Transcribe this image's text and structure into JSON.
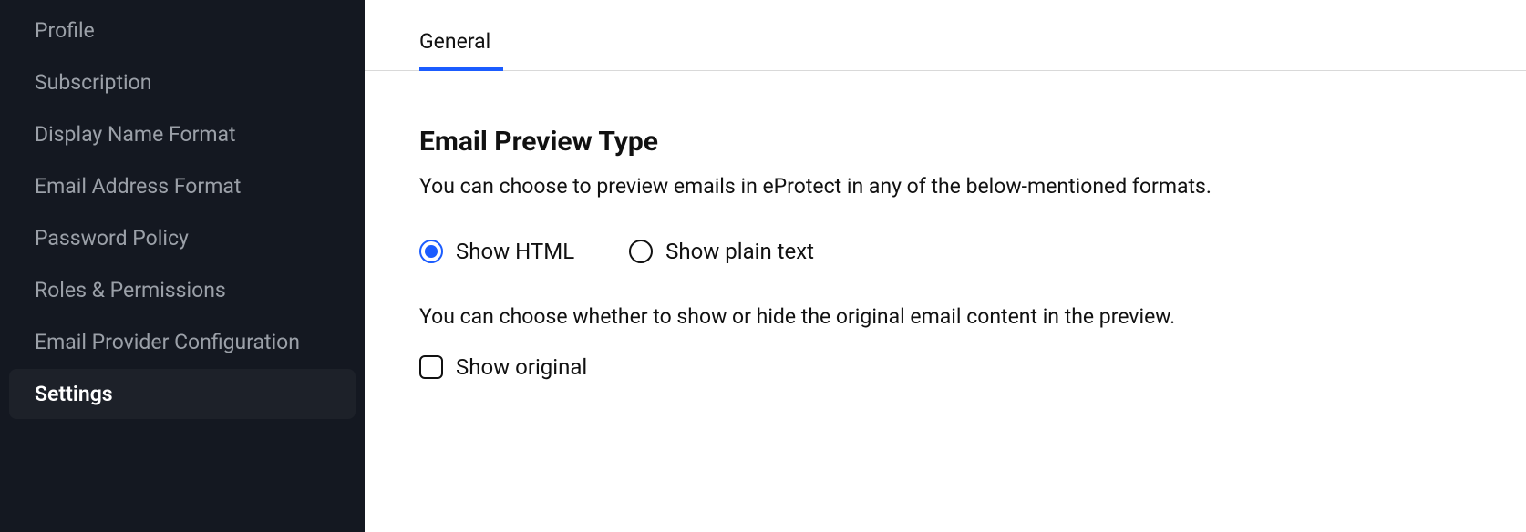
{
  "sidebar": {
    "items": [
      {
        "label": "Profile",
        "active": false
      },
      {
        "label": "Subscription",
        "active": false
      },
      {
        "label": "Display Name Format",
        "active": false
      },
      {
        "label": "Email Address Format",
        "active": false
      },
      {
        "label": "Password Policy",
        "active": false
      },
      {
        "label": "Roles & Permissions",
        "active": false
      },
      {
        "label": "Email Provider Configuration",
        "active": false
      },
      {
        "label": "Settings",
        "active": true
      }
    ]
  },
  "tabs": [
    {
      "label": "General",
      "active": true
    }
  ],
  "section": {
    "title": "Email Preview Type",
    "description": "You can choose to preview emails in eProtect in any of the below-mentioned formats.",
    "radios": [
      {
        "label": "Show HTML",
        "selected": true
      },
      {
        "label": "Show plain text",
        "selected": false
      }
    ],
    "sub_description": "You can choose whether to show or hide the original email content in the preview.",
    "checkbox": {
      "label": "Show original",
      "checked": false
    }
  }
}
